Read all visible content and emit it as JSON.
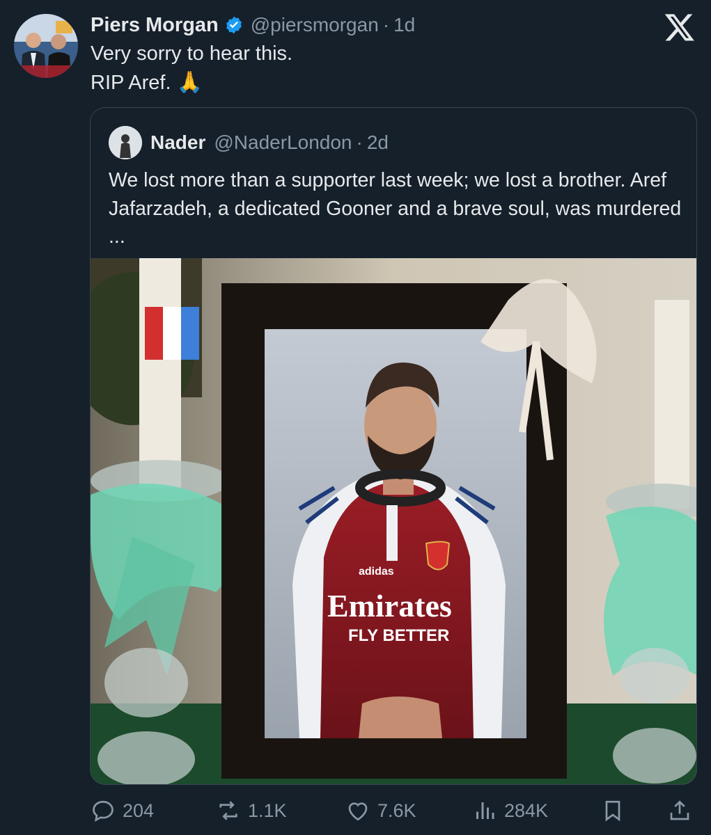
{
  "tweet": {
    "author": {
      "name": "Piers Morgan",
      "handle": "@piersmorgan",
      "time": "1d"
    },
    "dot": "·",
    "text_lines": [
      "Very sorry to hear this.",
      "RIP Aref."
    ],
    "emoji": "🙏"
  },
  "quote": {
    "author": {
      "name": "Nader",
      "handle": "@NaderLondon",
      "time": "2d"
    },
    "text": "We lost more than a supporter last week; we lost a brother. Aref Jafarzadeh, a dedicated Gooner and a brave soul, was murdered ...",
    "image": {
      "shirt_text_line1": "Emirates",
      "shirt_text_line2": "FLY BETTER",
      "brand": "adidas"
    }
  },
  "actions": {
    "replies": "204",
    "reposts": "1.1K",
    "likes": "7.6K",
    "views": "284K"
  },
  "colors": {
    "background": "#15202b",
    "text": "#e7e9ea",
    "secondary": "#8b98a5",
    "verified": "#1d9bf0",
    "border": "#38444d"
  }
}
